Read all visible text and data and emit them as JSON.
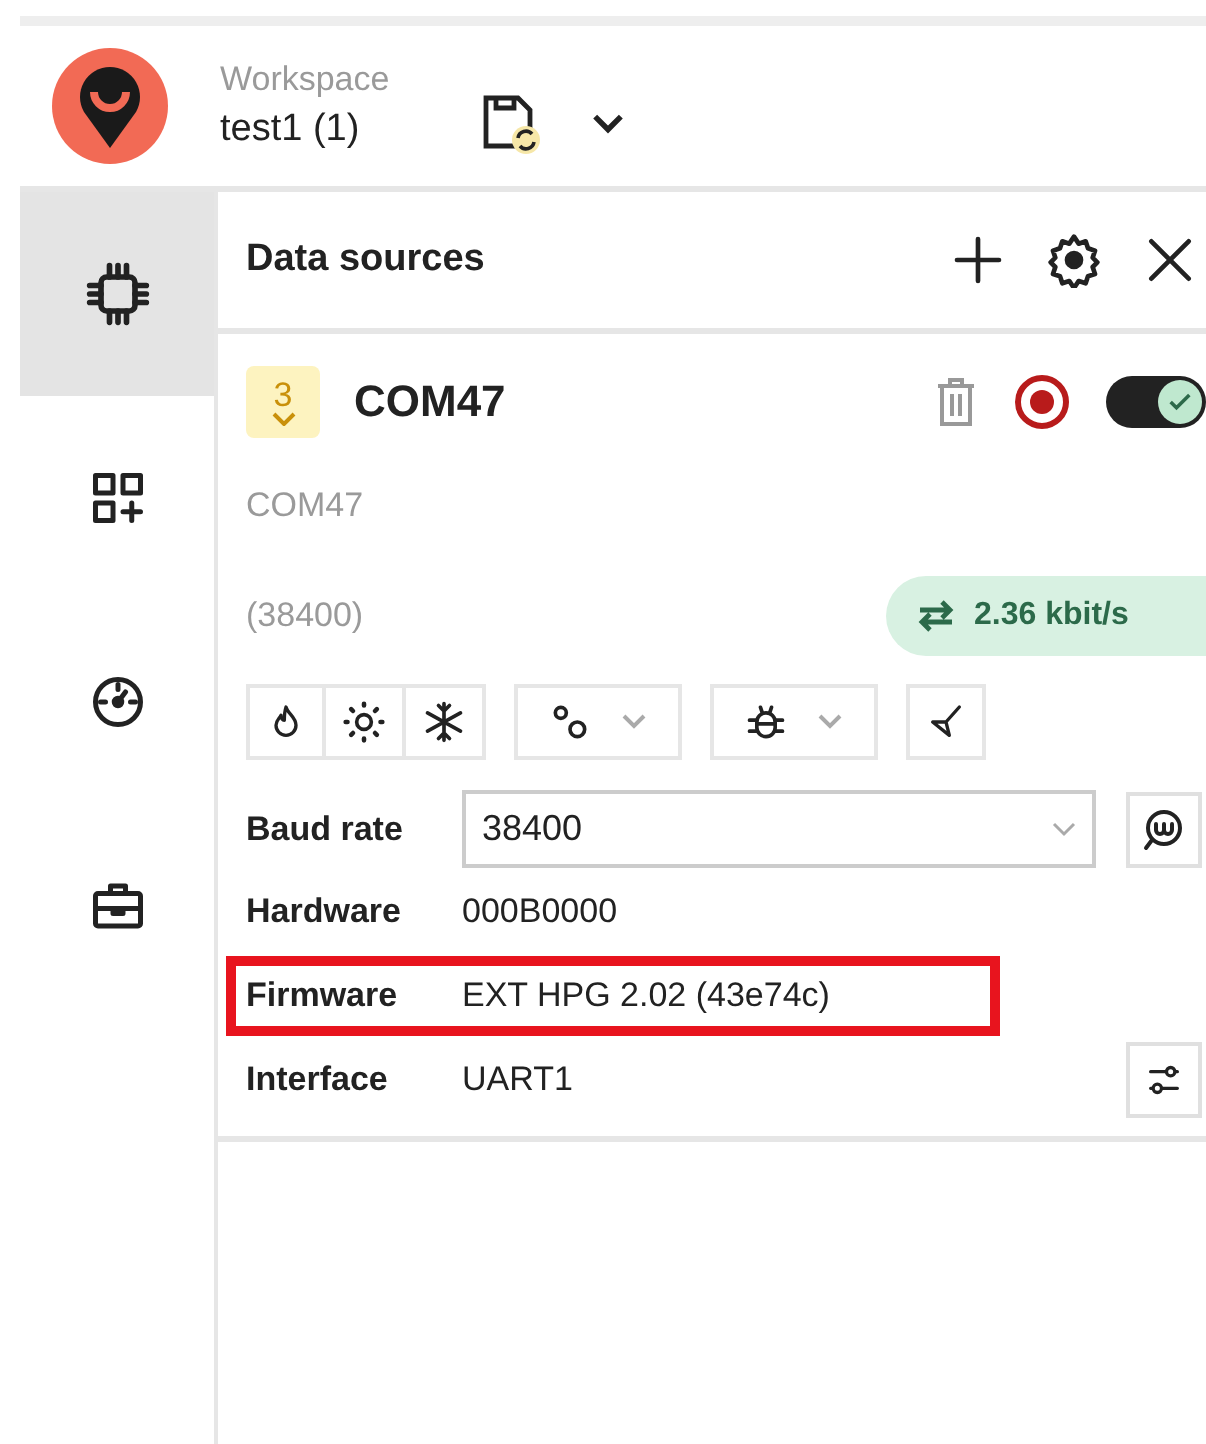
{
  "workspace": {
    "label": "Workspace",
    "name": "test1 (1)"
  },
  "sidebar": {
    "items": [
      {
        "kind": "chip",
        "selected": true
      },
      {
        "kind": "apps",
        "selected": false
      },
      {
        "kind": "gauge",
        "selected": false
      },
      {
        "kind": "toolbox",
        "selected": false
      }
    ]
  },
  "panel": {
    "title": "Data sources"
  },
  "source": {
    "badge": "3",
    "name": "COM47",
    "enabled": true,
    "port": "COM47",
    "baud_hint": "(38400)",
    "rate": "2.36 kbit/s",
    "baud_label": "Baud rate",
    "baud_value": "38400",
    "fields": [
      {
        "label": "Hardware",
        "value": "000B0000",
        "highlighted": false
      },
      {
        "label": "Firmware",
        "value": "EXT HPG 2.02 (43e74c)",
        "highlighted": true
      },
      {
        "label": "Interface",
        "value": "UART1",
        "highlighted": false
      }
    ]
  }
}
